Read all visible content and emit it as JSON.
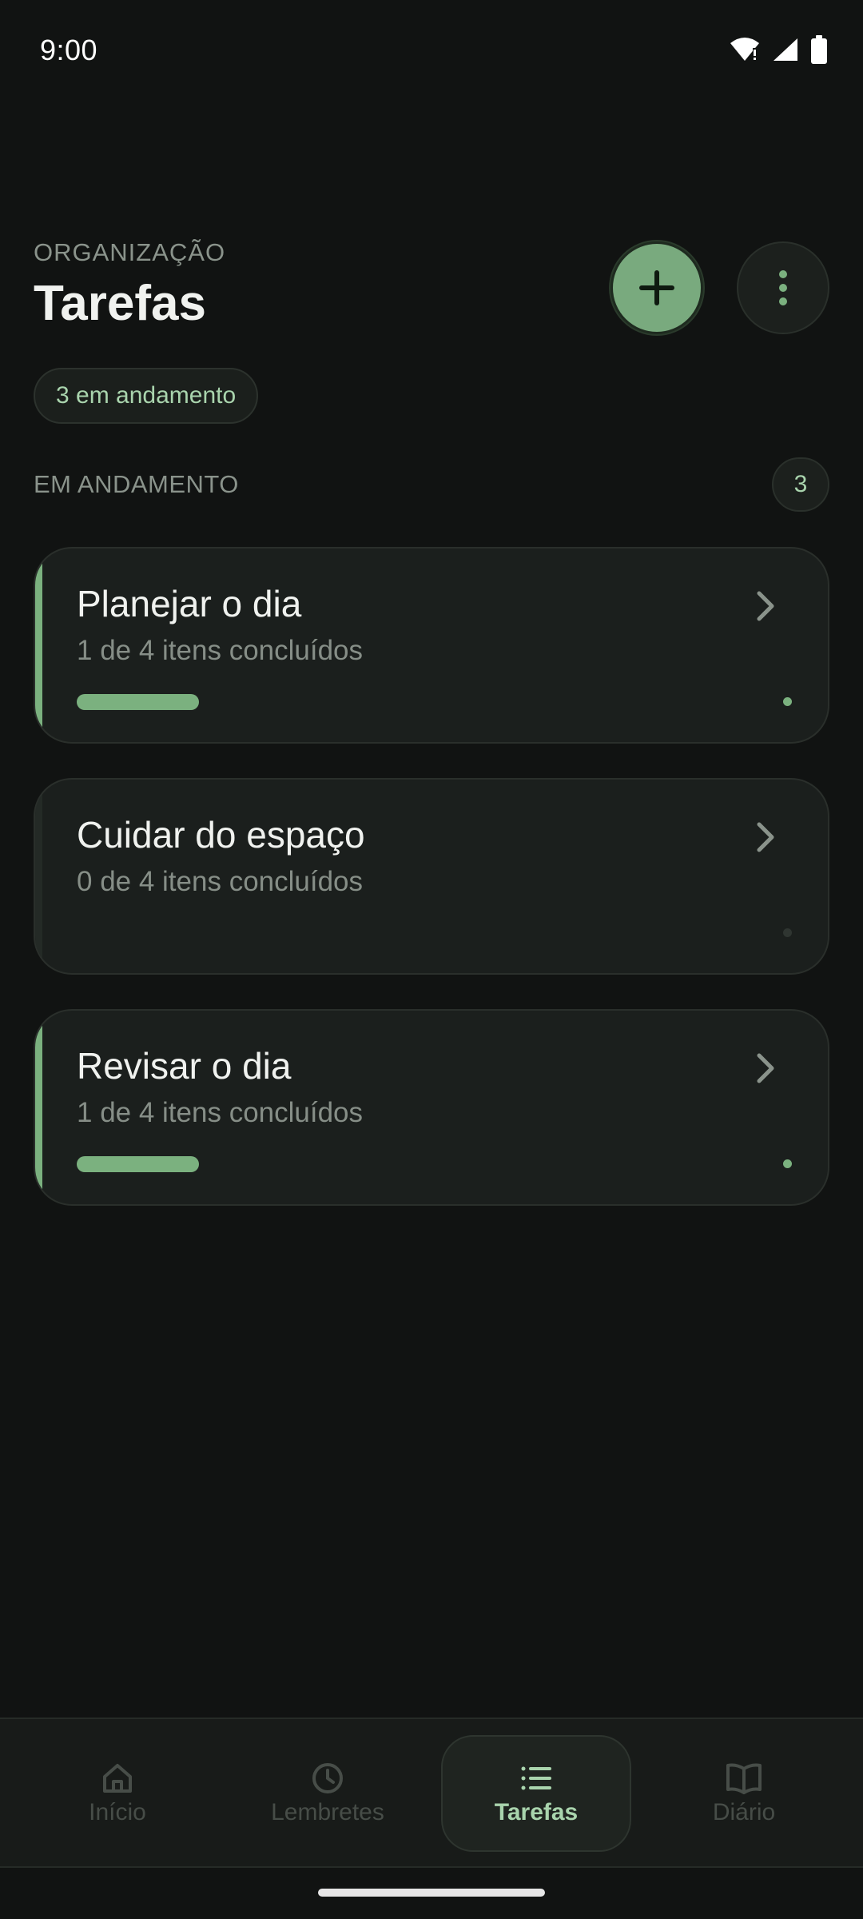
{
  "status_bar": {
    "time": "9:00"
  },
  "header": {
    "overline": "ORGANIZAÇÃO",
    "title": "Tarefas",
    "chip": "3 em andamento"
  },
  "section": {
    "label": "EM ANDAMENTO",
    "count": "3"
  },
  "colors": {
    "accent": "#7bb17f",
    "accent_text": "#a9d4ad",
    "background": "#111312",
    "card": "#1b1f1d"
  },
  "tasks": [
    {
      "title": "Planejar o dia",
      "subtitle": "1 de 4 itens concluídos",
      "progress": 0.25
    },
    {
      "title": "Cuidar do espaço",
      "subtitle": "0 de 4 itens concluídos",
      "progress": 0
    },
    {
      "title": "Revisar o dia",
      "subtitle": "1 de 4 itens concluídos",
      "progress": 0.25
    }
  ],
  "nav": {
    "items": [
      {
        "label": "Início",
        "icon": "home-icon",
        "active": false
      },
      {
        "label": "Lembretes",
        "icon": "clock-icon",
        "active": false
      },
      {
        "label": "Tarefas",
        "icon": "list-icon",
        "active": true
      },
      {
        "label": "Diário",
        "icon": "book-icon",
        "active": false
      }
    ]
  }
}
